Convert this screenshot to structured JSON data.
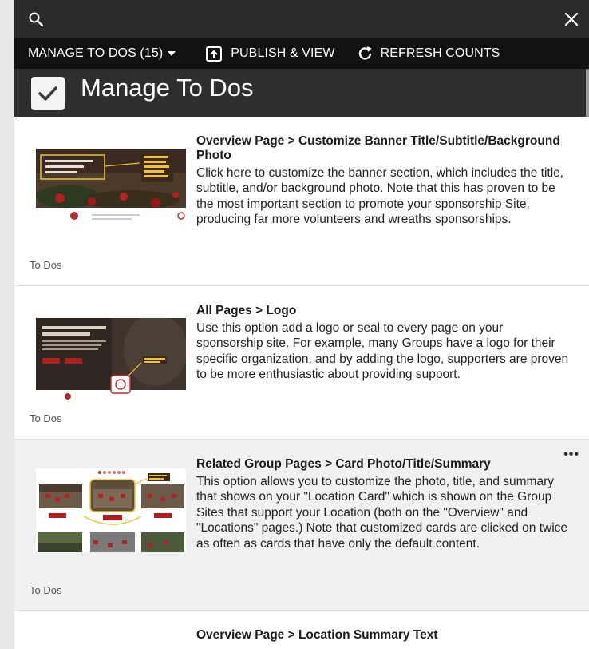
{
  "toolbar": {
    "manage_label": "MANAGE TO DOS (15)",
    "publish_label": "PUBLISH & VIEW",
    "refresh_label": "REFRESH COUNTS"
  },
  "header": {
    "title": "Manage To Dos"
  },
  "icons": {
    "search": "search-icon",
    "close": "close-icon",
    "dropdown": "caret-down-icon",
    "publish": "publish-icon",
    "refresh": "refresh-icon",
    "checkbox": "check-icon",
    "more": "more-horizontal-icon"
  },
  "colors": {
    "topbar": "#2b2b2b",
    "toolbar": "#111111",
    "highlight_row": "#f1f1f1"
  },
  "items": [
    {
      "title": "Overview Page > Customize Banner Title/Subtitle/Background Photo",
      "description": "Click here to customize the banner section, which includes the title, subtitle, and/or background photo. Note that this has proven to be the most important section to promote your sponsorship Site, producing far more volunteers and wreaths sponsorships.",
      "tag": "To Dos"
    },
    {
      "title": "All Pages > Logo",
      "description": "Use this option add a logo or seal to every page on your sponsorship site. For example, many Groups have a logo for their specific organization, and by adding the logo, supporters are proven to be more enthusiastic about providing support.",
      "tag": "To Dos"
    },
    {
      "title": "Related Group Pages > Card Photo/Title/Summary",
      "description": "This option allows you to customize the photo, title, and summary that shows on your \"Location Card\" which is shown  on the Group Sites that support your Location (both on the \"Overview\" and \"Locations\" pages.) Note that customized cards are clicked on twice as often as cards that have only the default content.",
      "tag": "To Dos",
      "more": "•••"
    },
    {
      "title": "Overview Page > Location Summary Text"
    }
  ]
}
